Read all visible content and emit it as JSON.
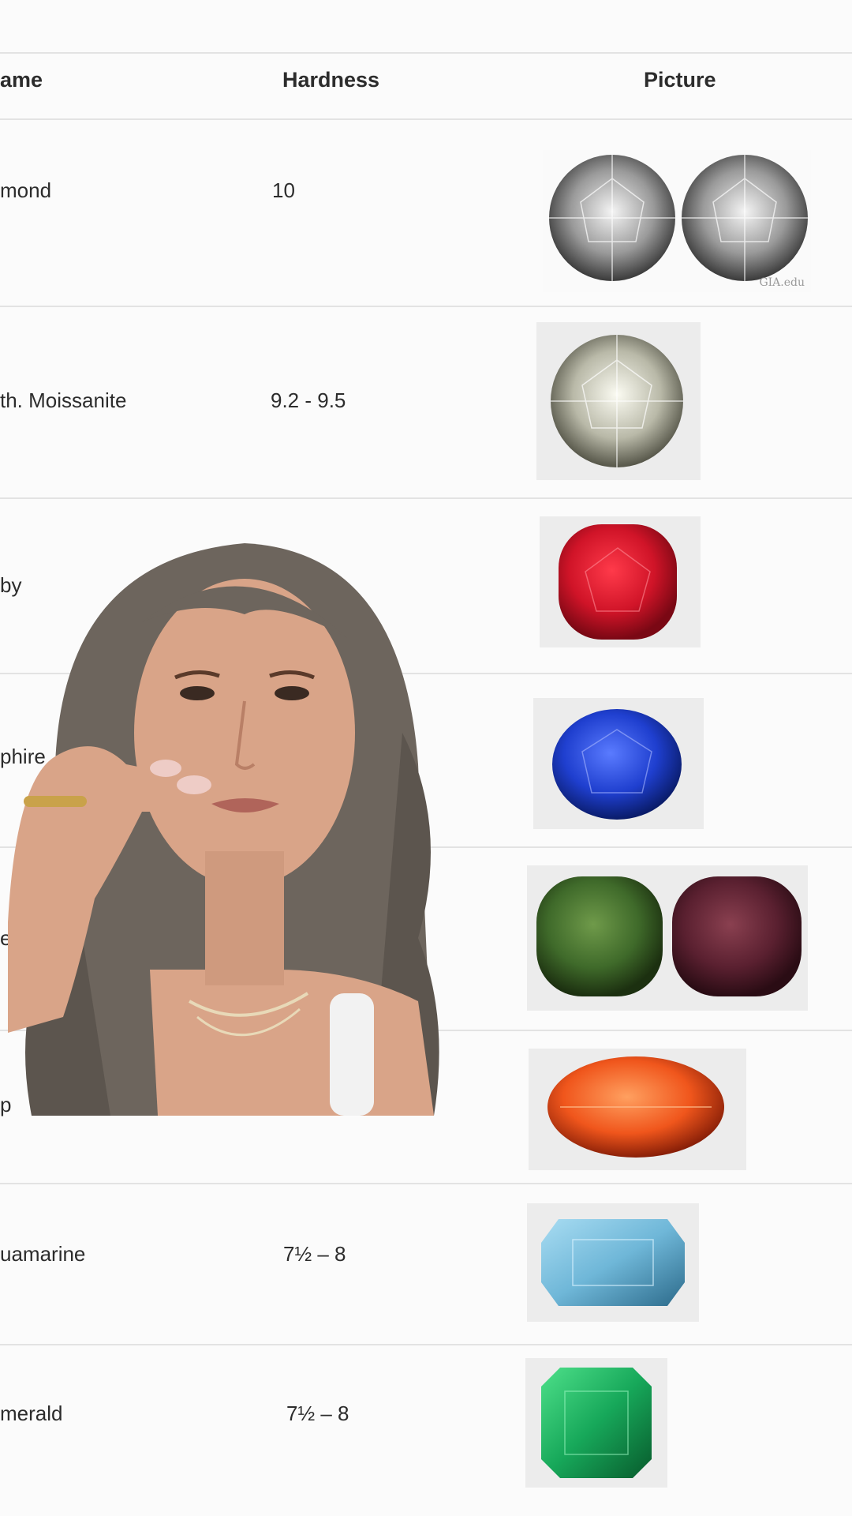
{
  "table": {
    "headers": {
      "name": "ame",
      "hardness": "Hardness",
      "picture": "Picture"
    },
    "rows": [
      {
        "name": "mond",
        "hardness": "10",
        "gem": "diamond",
        "color": "#d6d6d6"
      },
      {
        "name": "th. Moissanite",
        "hardness": "9.2 - 9.5",
        "gem": "moissanite",
        "color": "#e0e0d6"
      },
      {
        "name": "by",
        "hardness": "",
        "gem": "ruby",
        "color": "#d01428"
      },
      {
        "name": "phire",
        "hardness": "",
        "gem": "sapphire",
        "color": "#1f3fcf"
      },
      {
        "name": "ex",
        "hardness": "",
        "gem": "alexandrite",
        "colors": [
          "#3f6a2a",
          "#5a2030"
        ]
      },
      {
        "name": "p",
        "hardness": "",
        "gem": "topaz",
        "color": "#f0561c"
      },
      {
        "name": "uamarine",
        "hardness": "7½ – 8",
        "gem": "aquamarine",
        "color": "#6fb7d8"
      },
      {
        "name": "merald",
        "hardness": "7½ – 8",
        "gem": "emerald",
        "color": "#17a85a"
      }
    ],
    "watermark": "GIA.edu"
  },
  "overlay": {
    "type": "presenter-video-cutout",
    "hair_color": "#6d655d",
    "skin_color": "#d9a488"
  }
}
